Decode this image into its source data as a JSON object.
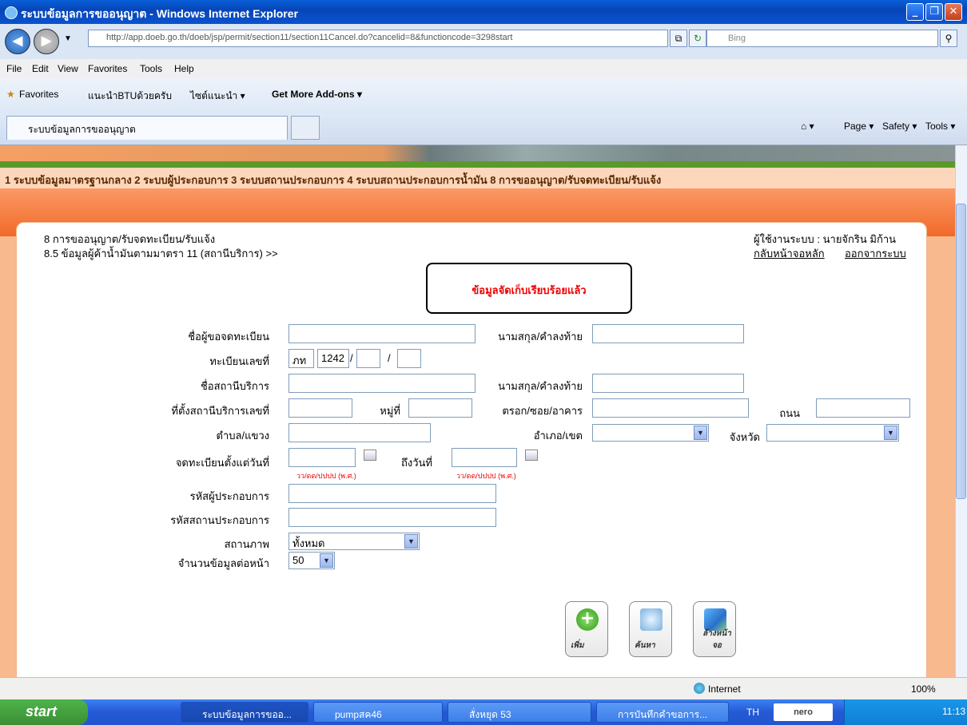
{
  "window": {
    "title": "ระบบข้อมูลการขออนุญาต - Windows Internet Explorer"
  },
  "browser": {
    "address": "http://app.doeb.go.th/doeb/jsp/permit/section11/section11Cancel.do?cancelid=8&functioncode=3298start",
    "search_placeholder": "Bing",
    "menu": [
      "File",
      "Edit",
      "View",
      "Favorites",
      "Tools",
      "Help"
    ],
    "favorites_label": "Favorites",
    "fav_items": [
      "แนะนำBTUด้วยครับ",
      "ไซต์แนะนำ ▾",
      "Get More Add-ons ▾"
    ],
    "tab_title": "ระบบข้อมูลการขออนุญาต",
    "commands": [
      "Page ▾",
      "Safety ▾",
      "Tools ▾"
    ]
  },
  "nav": {
    "line": "1 ระบบข้อมูลมาตรฐานกลาง  2 ระบบผู้ประกอบการ  3 ระบบสถานประกอบการ  4 ระบบสถานประกอบการน้ำมัน  8 การขออนุญาต/รับจดทะเบียน/รับแจ้ง"
  },
  "header": {
    "crumb1": "8 การขออนุญาต/รับจดทะเบียน/รับแจ้ง",
    "crumb2": "8.5 ข้อมูลผู้ค้าน้ำมันตามมาตรา 11 (สถานีบริการ) >>",
    "user": "ผู้ใช้งานระบบ : นายจักริน มิก้าน",
    "home_link": "กลับหน้าจอหลัก",
    "logout_link": "ออกจากระบบ"
  },
  "message": "ข้อมูลจัดเก็บเรียบร้อยแล้ว",
  "form": {
    "applicant_name": "ชื่อผู้ขอจดทะเบียน",
    "surname1": "นามสกุล/คำลงท้าย",
    "reg_no": "ทะเบียนเลขที่",
    "reg_prefix": "ภท",
    "reg_number": "1242",
    "station_name": "ชื่อสถานีบริการ",
    "surname2": "นามสกุล/คำลงท้าย",
    "location_no": "ที่ตั้งสถานีบริการเลขที่",
    "moo": "หมู่ที่",
    "soi": "ตรอก/ซอย/อาคาร",
    "road": "ถนน",
    "tambon": "ตำบล/แขวง",
    "amphoe": "อำเภอ/เขต",
    "province": "จังหวัด",
    "reg_from": "จดทะเบียนตั้งแต่วันที่",
    "reg_to": "ถึงวันที่",
    "date_hint": "วว/ดด/ปปปป (พ.ศ.)",
    "operator_code": "รหัสผู้ประกอบการ",
    "establishment_code": "รหัสสถานประกอบการ",
    "status": "สถานภาพ",
    "status_value": "ทั้งหมด",
    "per_page": "จำนวนข้อมูลต่อหน้า",
    "per_page_value": "50"
  },
  "buttons": {
    "add": "เพิ่ม",
    "search": "ค้นหา",
    "clear": "ล้างหน้าจอ"
  },
  "status_bar": {
    "zone": "Internet",
    "zoom": "100%"
  },
  "taskbar": {
    "start": "start",
    "tasks": [
      "ระบบข้อมูลการขออ...",
      "pumpสค46",
      "สั่งหยุด 53",
      "การบันทึกคำขอการ..."
    ],
    "lang": "TH",
    "nero": "nero",
    "clock": "11:13"
  }
}
